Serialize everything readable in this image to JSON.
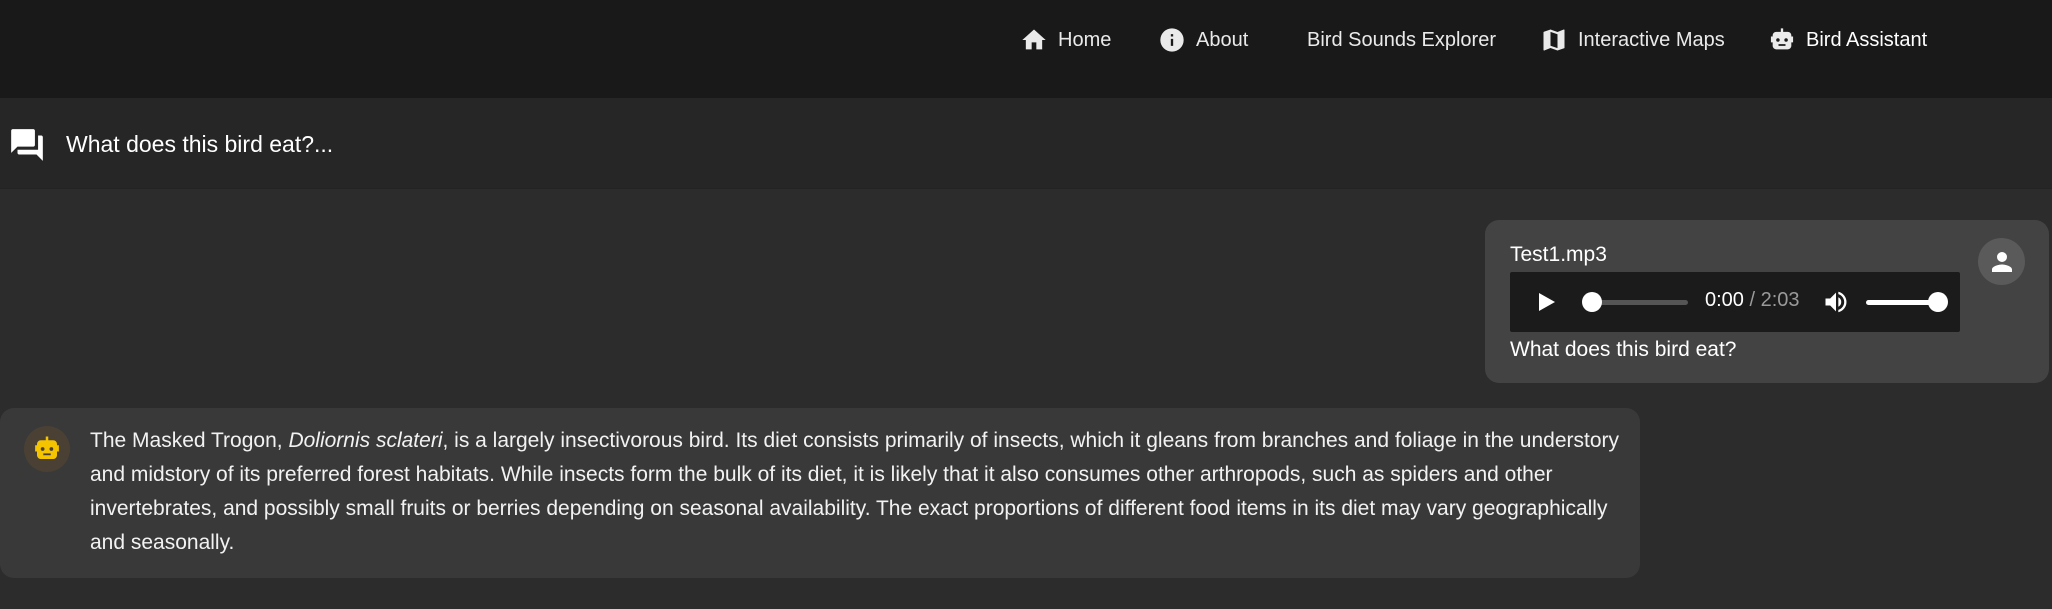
{
  "nav": {
    "items": [
      {
        "label": "Home",
        "icon": "home-icon"
      },
      {
        "label": "About",
        "icon": "info-icon"
      },
      {
        "label": "Bird Sounds Explorer",
        "icon": ""
      },
      {
        "label": "Interactive Maps",
        "icon": "map-icon"
      },
      {
        "label": "Bird Assistant",
        "icon": "robot-icon",
        "active": true
      }
    ]
  },
  "chat": {
    "title": "What does this bird eat?...",
    "title_icon": "chat-bubbles-icon"
  },
  "user_message": {
    "file_name": "Test1.mp3",
    "audio": {
      "current_time": "0:00",
      "separator": " / ",
      "duration": "2:03",
      "progress": 0.0,
      "volume": 1.0
    },
    "text": "What does this bird eat?",
    "avatar_icon": "person-icon"
  },
  "bot_message": {
    "avatar_icon": "robot-icon",
    "prefix": "The Masked Trogon, ",
    "italic": "Doliornis sclateri",
    "suffix": ", is a largely insectivorous bird. Its diet consists primarily of insects, which it gleans from branches and foliage in the understory and midstory of its preferred forest habitats. While insects form the bulk of its diet, it is likely that it also consumes other arthropods, such as spiders and other invertebrates, and possibly small fruits or berries depending on seasonal availability. The exact proportions of different food items in its diet may vary geographically and seasonally."
  },
  "colors": {
    "navbar_bg": "#191919",
    "page_bg": "#2c2c2c",
    "user_bubble": "#434343",
    "bot_bubble": "#393939",
    "bot_accent": "#f5c400"
  }
}
